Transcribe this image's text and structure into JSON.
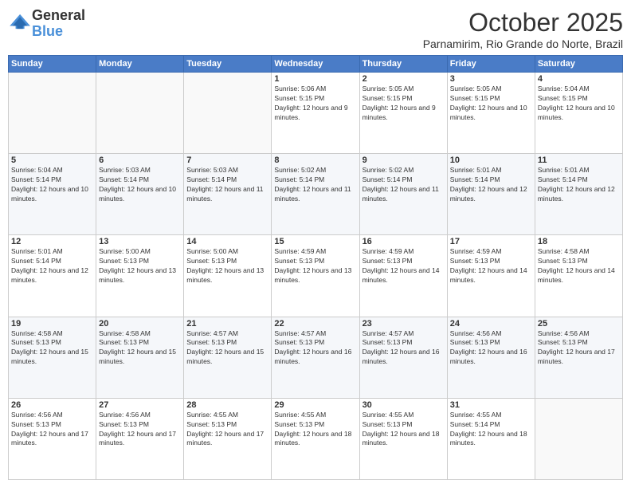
{
  "logo": {
    "general": "General",
    "blue": "Blue"
  },
  "header": {
    "month": "October 2025",
    "location": "Parnamirim, Rio Grande do Norte, Brazil"
  },
  "weekdays": [
    "Sunday",
    "Monday",
    "Tuesday",
    "Wednesday",
    "Thursday",
    "Friday",
    "Saturday"
  ],
  "weeks": [
    [
      {
        "day": "",
        "sunrise": "",
        "sunset": "",
        "daylight": ""
      },
      {
        "day": "",
        "sunrise": "",
        "sunset": "",
        "daylight": ""
      },
      {
        "day": "",
        "sunrise": "",
        "sunset": "",
        "daylight": ""
      },
      {
        "day": "1",
        "sunrise": "5:06 AM",
        "sunset": "5:15 PM",
        "daylight": "12 hours and 9 minutes."
      },
      {
        "day": "2",
        "sunrise": "5:05 AM",
        "sunset": "5:15 PM",
        "daylight": "12 hours and 9 minutes."
      },
      {
        "day": "3",
        "sunrise": "5:05 AM",
        "sunset": "5:15 PM",
        "daylight": "12 hours and 10 minutes."
      },
      {
        "day": "4",
        "sunrise": "5:04 AM",
        "sunset": "5:15 PM",
        "daylight": "12 hours and 10 minutes."
      }
    ],
    [
      {
        "day": "5",
        "sunrise": "5:04 AM",
        "sunset": "5:14 PM",
        "daylight": "12 hours and 10 minutes."
      },
      {
        "day": "6",
        "sunrise": "5:03 AM",
        "sunset": "5:14 PM",
        "daylight": "12 hours and 10 minutes."
      },
      {
        "day": "7",
        "sunrise": "5:03 AM",
        "sunset": "5:14 PM",
        "daylight": "12 hours and 11 minutes."
      },
      {
        "day": "8",
        "sunrise": "5:02 AM",
        "sunset": "5:14 PM",
        "daylight": "12 hours and 11 minutes."
      },
      {
        "day": "9",
        "sunrise": "5:02 AM",
        "sunset": "5:14 PM",
        "daylight": "12 hours and 11 minutes."
      },
      {
        "day": "10",
        "sunrise": "5:01 AM",
        "sunset": "5:14 PM",
        "daylight": "12 hours and 12 minutes."
      },
      {
        "day": "11",
        "sunrise": "5:01 AM",
        "sunset": "5:14 PM",
        "daylight": "12 hours and 12 minutes."
      }
    ],
    [
      {
        "day": "12",
        "sunrise": "5:01 AM",
        "sunset": "5:14 PM",
        "daylight": "12 hours and 12 minutes."
      },
      {
        "day": "13",
        "sunrise": "5:00 AM",
        "sunset": "5:13 PM",
        "daylight": "12 hours and 13 minutes."
      },
      {
        "day": "14",
        "sunrise": "5:00 AM",
        "sunset": "5:13 PM",
        "daylight": "12 hours and 13 minutes."
      },
      {
        "day": "15",
        "sunrise": "4:59 AM",
        "sunset": "5:13 PM",
        "daylight": "12 hours and 13 minutes."
      },
      {
        "day": "16",
        "sunrise": "4:59 AM",
        "sunset": "5:13 PM",
        "daylight": "12 hours and 14 minutes."
      },
      {
        "day": "17",
        "sunrise": "4:59 AM",
        "sunset": "5:13 PM",
        "daylight": "12 hours and 14 minutes."
      },
      {
        "day": "18",
        "sunrise": "4:58 AM",
        "sunset": "5:13 PM",
        "daylight": "12 hours and 14 minutes."
      }
    ],
    [
      {
        "day": "19",
        "sunrise": "4:58 AM",
        "sunset": "5:13 PM",
        "daylight": "12 hours and 15 minutes."
      },
      {
        "day": "20",
        "sunrise": "4:58 AM",
        "sunset": "5:13 PM",
        "daylight": "12 hours and 15 minutes."
      },
      {
        "day": "21",
        "sunrise": "4:57 AM",
        "sunset": "5:13 PM",
        "daylight": "12 hours and 15 minutes."
      },
      {
        "day": "22",
        "sunrise": "4:57 AM",
        "sunset": "5:13 PM",
        "daylight": "12 hours and 16 minutes."
      },
      {
        "day": "23",
        "sunrise": "4:57 AM",
        "sunset": "5:13 PM",
        "daylight": "12 hours and 16 minutes."
      },
      {
        "day": "24",
        "sunrise": "4:56 AM",
        "sunset": "5:13 PM",
        "daylight": "12 hours and 16 minutes."
      },
      {
        "day": "25",
        "sunrise": "4:56 AM",
        "sunset": "5:13 PM",
        "daylight": "12 hours and 17 minutes."
      }
    ],
    [
      {
        "day": "26",
        "sunrise": "4:56 AM",
        "sunset": "5:13 PM",
        "daylight": "12 hours and 17 minutes."
      },
      {
        "day": "27",
        "sunrise": "4:56 AM",
        "sunset": "5:13 PM",
        "daylight": "12 hours and 17 minutes."
      },
      {
        "day": "28",
        "sunrise": "4:55 AM",
        "sunset": "5:13 PM",
        "daylight": "12 hours and 17 minutes."
      },
      {
        "day": "29",
        "sunrise": "4:55 AM",
        "sunset": "5:13 PM",
        "daylight": "12 hours and 18 minutes."
      },
      {
        "day": "30",
        "sunrise": "4:55 AM",
        "sunset": "5:13 PM",
        "daylight": "12 hours and 18 minutes."
      },
      {
        "day": "31",
        "sunrise": "4:55 AM",
        "sunset": "5:14 PM",
        "daylight": "12 hours and 18 minutes."
      },
      {
        "day": "",
        "sunrise": "",
        "sunset": "",
        "daylight": ""
      }
    ]
  ]
}
